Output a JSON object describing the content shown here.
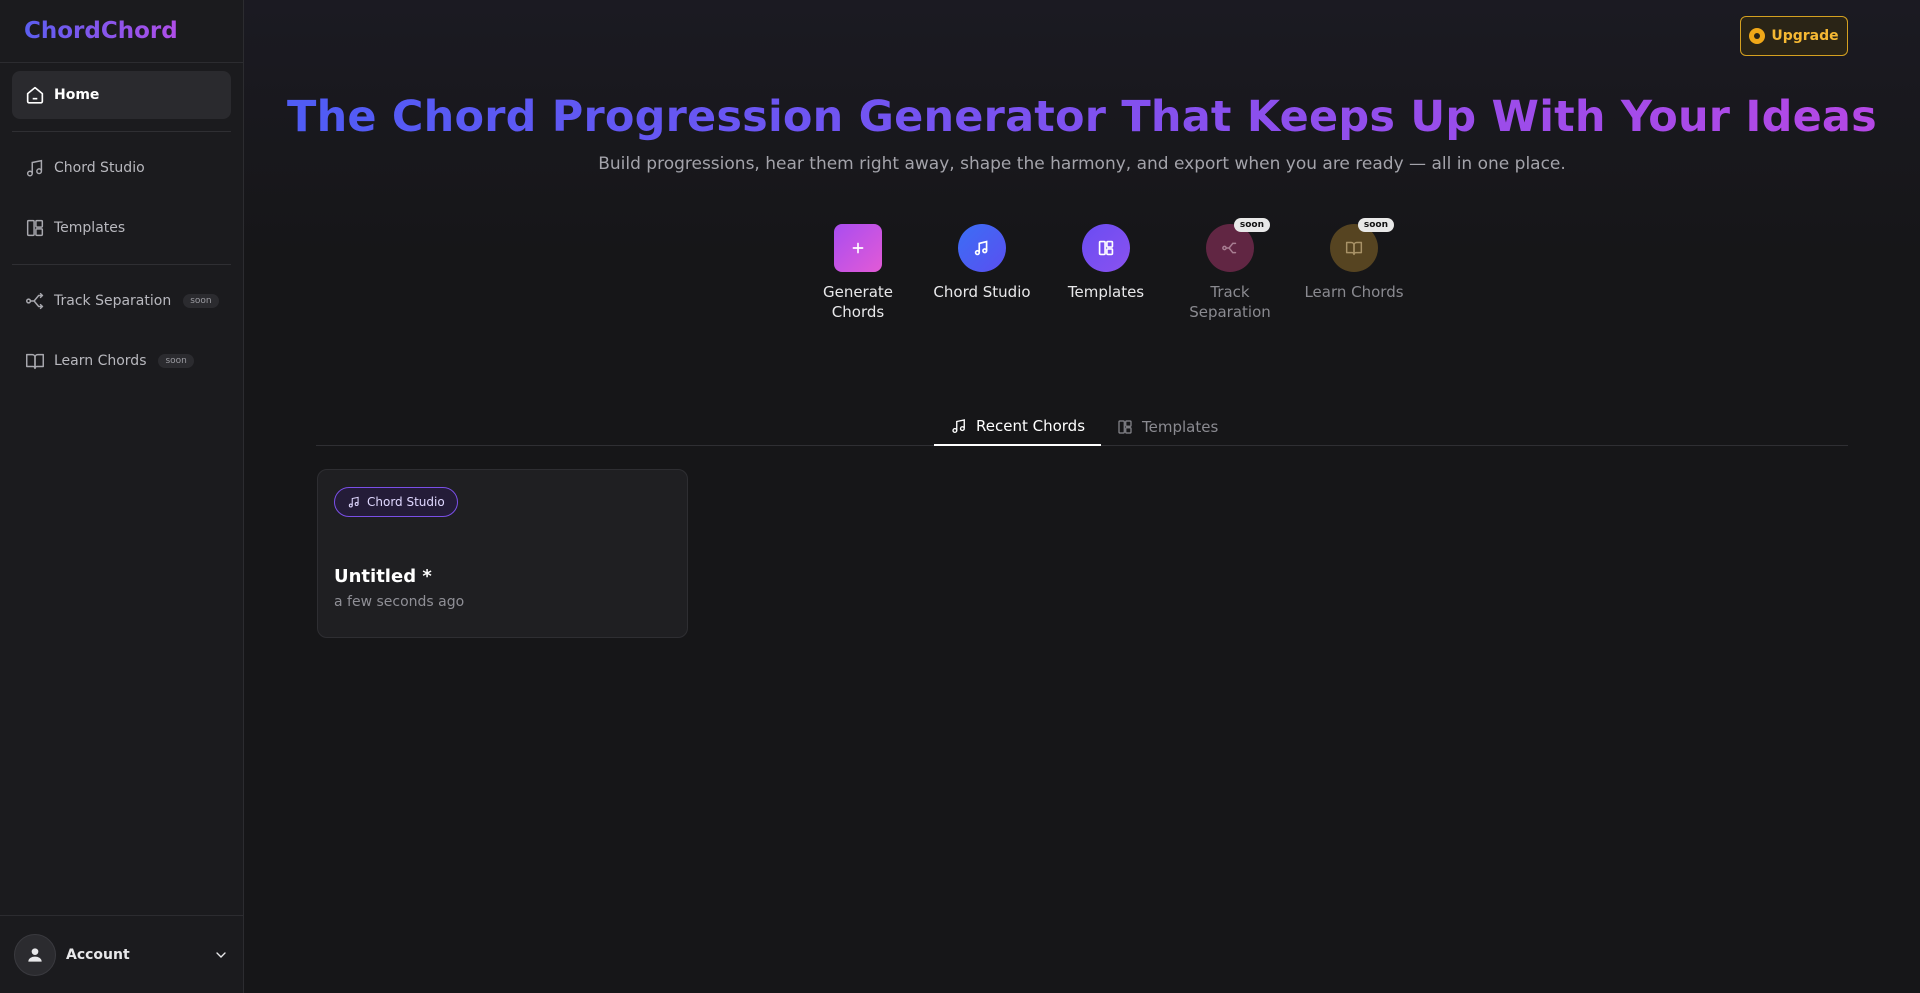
{
  "sidebar": {
    "brand": "ChordChord",
    "items": [
      {
        "label": "Home"
      },
      {
        "label": "Chord Studio"
      },
      {
        "label": "Templates"
      },
      {
        "label": "Track Separation",
        "badge": "soon"
      },
      {
        "label": "Learn Chords",
        "badge": "soon"
      }
    ],
    "account_label": "Account"
  },
  "header": {
    "upgrade_label": "Upgrade"
  },
  "hero": {
    "title": "The Chord Progression Generator That Keeps Up With Your Ideas",
    "subtitle": "Build progressions, hear them right away, shape the harmony, and export when you are ready — all in one place."
  },
  "actions": [
    {
      "label": "Generate Chords",
      "icon": "plus-icon"
    },
    {
      "label": "Chord Studio",
      "icon": "music-note-icon"
    },
    {
      "label": "Templates",
      "icon": "layout-icon"
    },
    {
      "label": "Track Separation",
      "icon": "split-icon",
      "badge": "soon"
    },
    {
      "label": "Learn Chords",
      "icon": "book-icon",
      "badge": "soon"
    }
  ],
  "tabs": [
    {
      "label": "Recent Chords",
      "active": true
    },
    {
      "label": "Templates",
      "active": false
    }
  ],
  "recent": [
    {
      "chip": "Chord Studio",
      "title": "Untitled *",
      "time": "a few seconds ago"
    }
  ],
  "colors": {
    "accent_blue": "#4f5cf5",
    "accent_purple": "#b548e6",
    "upgrade_gold": "#f5b833"
  }
}
